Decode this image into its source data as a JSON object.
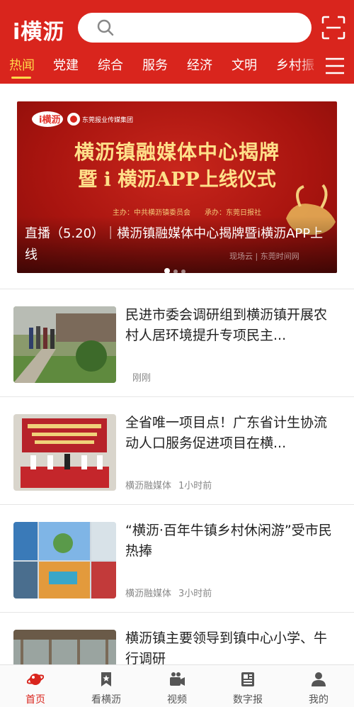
{
  "header": {
    "logo": "i横沥",
    "search_placeholder": ""
  },
  "tabs": [
    {
      "label": "热闻",
      "active": true
    },
    {
      "label": "党建"
    },
    {
      "label": "综合"
    },
    {
      "label": "服务"
    },
    {
      "label": "经济"
    },
    {
      "label": "文明"
    },
    {
      "label": "乡村振"
    }
  ],
  "banner": {
    "title_line1": "横沥镇融媒体中心揭牌",
    "title_line2": "暨 i 横沥APP上线仪式",
    "organizers": "主办：中共横沥镇委员会　　承办：东莞日报社",
    "publisher": "东莞报业传媒集团",
    "caption": "直播（5.20）｜横沥镇融媒体中心揭牌暨i横沥APP上线",
    "watermark": "现场云 | 东莞时间网",
    "slide_count": 3,
    "active_slide": 1
  },
  "news": [
    {
      "title": "民进市委会调研组到横沥镇开展农村人居环境提升专项民主...",
      "source": "",
      "time": "刚刚"
    },
    {
      "title": "全省唯一项目点！广东省计生协流动人口服务促进项目在横...",
      "source": "横沥融媒体",
      "time": "1小时前"
    },
    {
      "title": "“横沥·百年牛镇乡村休闲游”受市民热捧",
      "source": "横沥融媒体",
      "time": "3小时前"
    },
    {
      "title": "横沥镇主要领导到镇中心小学、牛行调研",
      "source": "",
      "time": ""
    }
  ],
  "bottom_nav": [
    {
      "label": "首页",
      "icon": "home-planet-icon",
      "active": true
    },
    {
      "label": "看横沥",
      "icon": "bookmark-icon"
    },
    {
      "label": "视频",
      "icon": "video-camera-icon"
    },
    {
      "label": "数字报",
      "icon": "newspaper-icon"
    },
    {
      "label": "我的",
      "icon": "user-icon"
    }
  ],
  "colors": {
    "brand_red": "#d9251d",
    "tab_active": "#ffd84a",
    "banner_gold": "#ffe08a"
  }
}
